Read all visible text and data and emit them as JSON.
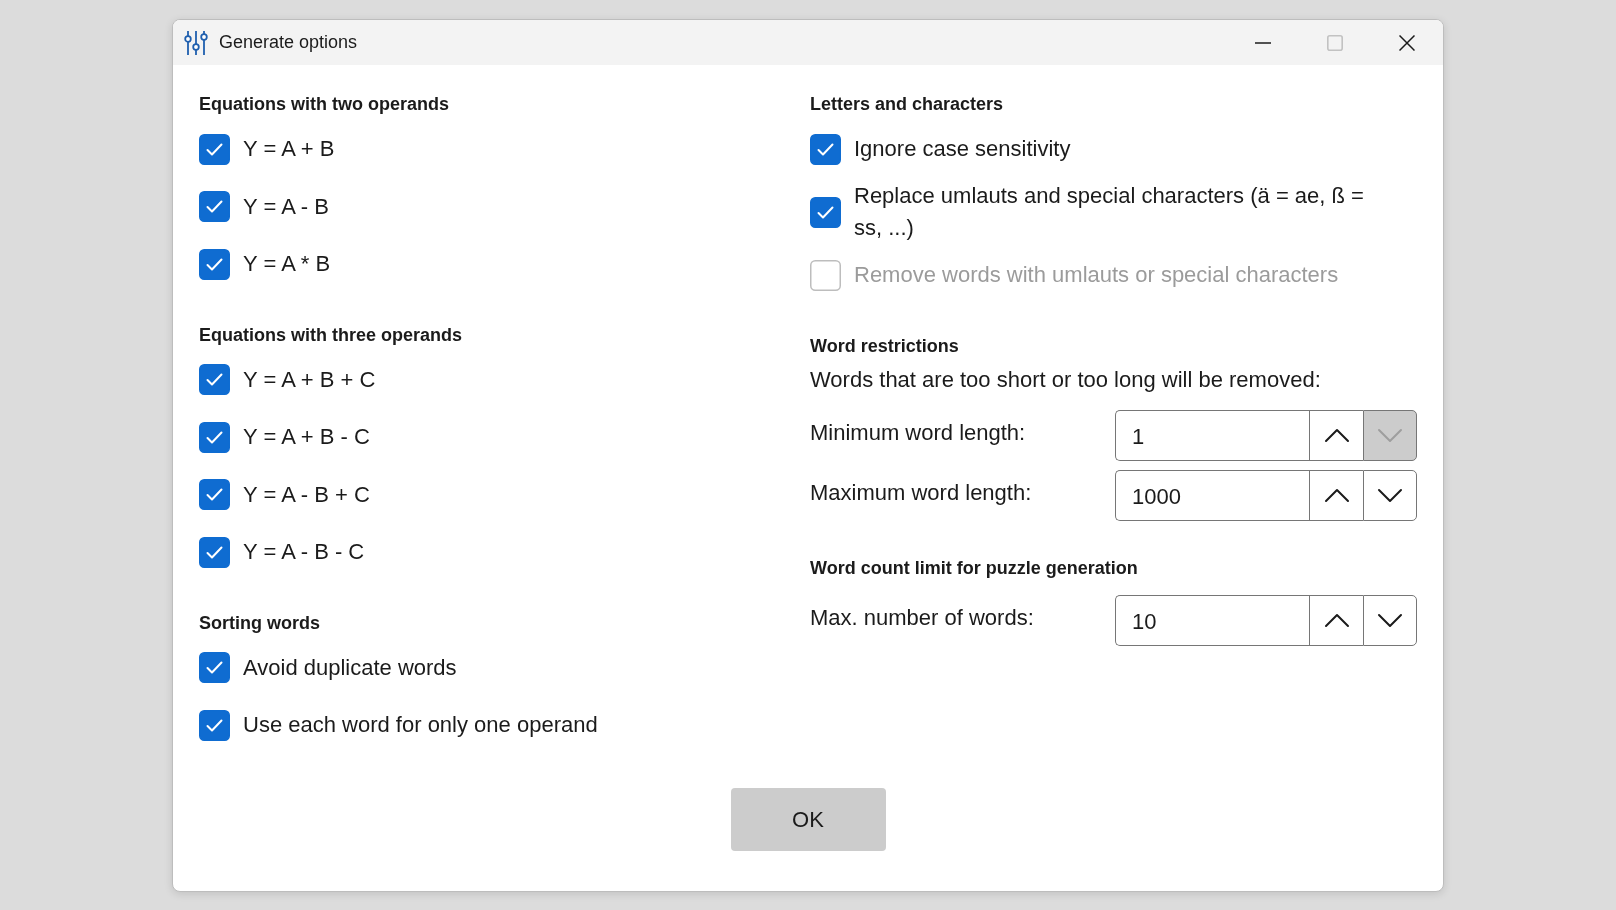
{
  "window": {
    "title": "Generate options",
    "controls": [
      {
        "kind": "minimize",
        "disabled": false
      },
      {
        "kind": "maximize",
        "disabled": true
      },
      {
        "kind": "close",
        "disabled": false
      }
    ]
  },
  "left_column": [
    {
      "heading": "Equations with two operands",
      "options": [
        {
          "label": "Y = A + B",
          "checked": true,
          "disabled": false
        },
        {
          "label": "Y = A - B",
          "checked": true,
          "disabled": false
        },
        {
          "label": "Y = A * B",
          "checked": true,
          "disabled": false
        }
      ]
    },
    {
      "heading": "Equations with three operands",
      "options": [
        {
          "label": "Y = A + B + C",
          "checked": true,
          "disabled": false
        },
        {
          "label": "Y = A + B - C",
          "checked": true,
          "disabled": false
        },
        {
          "label": "Y = A - B + C",
          "checked": true,
          "disabled": false
        },
        {
          "label": "Y = A - B - C",
          "checked": true,
          "disabled": false
        }
      ]
    },
    {
      "heading": "Sorting words",
      "options": [
        {
          "label": "Avoid duplicate words",
          "checked": true,
          "disabled": false
        },
        {
          "label": "Use each word for only one operand",
          "checked": true,
          "disabled": false
        }
      ]
    }
  ],
  "right_column": [
    {
      "heading": "Letters and characters",
      "options": [
        {
          "label": "Ignore case sensitivity",
          "checked": true,
          "disabled": false
        },
        {
          "label": "Replace umlauts and special characters (ä = ae, ß = ss, ...)",
          "checked": true,
          "disabled": false
        },
        {
          "label": "Remove words with umlauts or special characters",
          "checked": false,
          "disabled": true
        }
      ]
    },
    {
      "heading": "Word restrictions",
      "description": "Words that are too short or too long will be removed:",
      "spinboxes": [
        {
          "label": "Minimum word length:",
          "value": "1",
          "buttons": [
            {
              "kind": "up",
              "disabled": false
            },
            {
              "kind": "down",
              "disabled": true
            }
          ]
        },
        {
          "label": "Maximum word length:",
          "value": "1000",
          "buttons": [
            {
              "kind": "up",
              "disabled": false
            },
            {
              "kind": "down",
              "disabled": false
            }
          ]
        }
      ]
    },
    {
      "heading": "Word count limit for puzzle generation",
      "spinboxes": [
        {
          "label": "Max. number of words:",
          "value": "10",
          "buttons": [
            {
              "kind": "up",
              "disabled": false
            },
            {
              "kind": "down",
              "disabled": false
            }
          ]
        }
      ]
    }
  ],
  "buttons": [
    "OK"
  ]
}
